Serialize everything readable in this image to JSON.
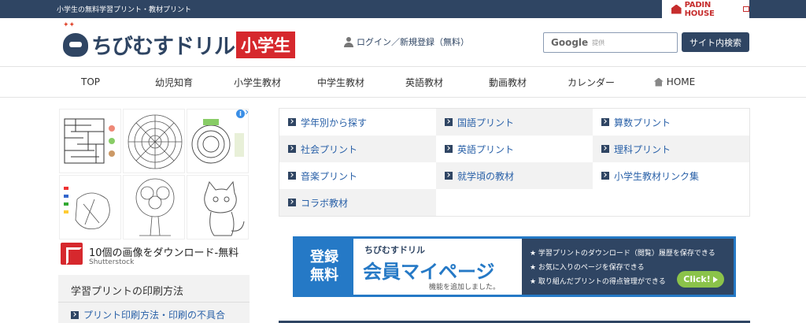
{
  "topbar": {
    "tagline": "小学生の無料学習プリント・教材プリント",
    "padin_label": "PADIN HOUSE"
  },
  "header": {
    "logo_name": "ちびむすドリル",
    "logo_grade": "小学生",
    "login_label": "ログイン／新規登録（無料）",
    "search_brand": "Google",
    "search_placeholder": "提供",
    "search_button": "サイト内検索"
  },
  "nav": {
    "items": [
      "TOP",
      "幼児知育",
      "小学生教材",
      "中学生教材",
      "英語教材",
      "動画教材",
      "カレンダー",
      "HOME"
    ]
  },
  "ad": {
    "title": "10個の画像をダウンロード-無料",
    "source": "Shutterstock",
    "info": "i",
    "close": "✕"
  },
  "sidebar": {
    "heading": "学習プリントの印刷方法",
    "link": "プリント印刷方法・印刷の不具合"
  },
  "categories": [
    "学年別から探す",
    "国語プリント",
    "算数プリント",
    "社会プリント",
    "英語プリント",
    "理科プリント",
    "音楽プリント",
    "就学頃の教材",
    "小学生教材リンク集",
    "コラボ教材"
  ],
  "banner": {
    "left_line1": "登録",
    "left_line2": "無料",
    "brand": "ちびむすドリル",
    "title": "会員マイページ",
    "subtitle": "機能を追加しました。",
    "features": [
      "★ 学習プリントのダウンロード（閲覧）履歴を保存できる",
      "★ お気に入りのページを保存できる",
      "★ 取り組んだプリントの得点管理ができる"
    ],
    "cta": "Click!"
  },
  "colors": {
    "navy": "#2f4563",
    "red": "#d6282d",
    "link": "#2a61a8",
    "banner_blue": "#2579c6",
    "cta_green": "#8bc34a"
  }
}
